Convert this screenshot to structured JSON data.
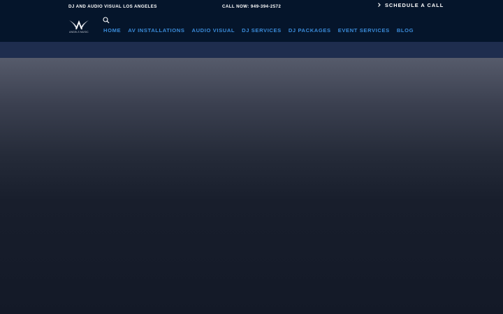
{
  "topbar": {
    "tagline": "DJ AND AUDIO VISUAL LOS ANGELES",
    "phone": "CALL NOW: 949-394-2572",
    "schedule_label": "SCHEDULE A CALL"
  },
  "logo": {
    "text": "ANGELS MUSIC"
  },
  "nav": {
    "items": [
      {
        "label": "HOME"
      },
      {
        "label": "AV INSTALLATIONS"
      },
      {
        "label": "AUDIO VISUAL"
      },
      {
        "label": "DJ SERVICES"
      },
      {
        "label": "DJ PACKAGES"
      },
      {
        "label": "EVENT SERVICES"
      },
      {
        "label": "BLOG"
      }
    ]
  },
  "colors": {
    "header_bg": "#05152b",
    "nav_link": "#3a8bd9",
    "band": "#1e2d4e"
  },
  "icons": {
    "search": "search-icon",
    "schedule": "chevron-right-icon"
  }
}
